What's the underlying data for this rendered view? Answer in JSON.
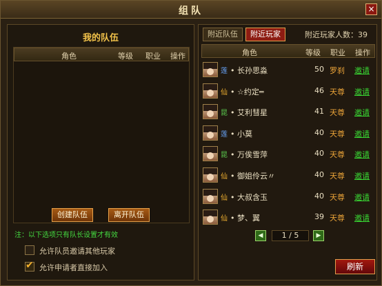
{
  "window": {
    "title": "组队",
    "close_icon": "×"
  },
  "my_team": {
    "title": "我的队伍",
    "columns": [
      "角色",
      "等级",
      "职业",
      "操作"
    ],
    "create_button": "创建队伍",
    "leave_button": "离开队伍",
    "note": "注：以下选项只有队长设置才有效",
    "options": [
      {
        "label": "允许队员邀请其他玩家",
        "checked": false
      },
      {
        "label": "允许申请者直接加入",
        "checked": true
      }
    ],
    "checkmark": "✔"
  },
  "nearby": {
    "tabs": [
      {
        "label": "附近队伍",
        "active": false
      },
      {
        "label": "附近玩家",
        "active": true
      }
    ],
    "count_label": "附近玩家人数：39",
    "columns": [
      "角色",
      "等级",
      "职业",
      "操作"
    ],
    "players": [
      {
        "cls": "莲",
        "cls_color": "#6aa8ff",
        "name": "• 长孙思淼",
        "level": "50",
        "job": "罗刹",
        "action": "邀请"
      },
      {
        "cls": "仙",
        "cls_color": "#f0b030",
        "name": "• ☆约定═",
        "level": "46",
        "job": "天尊",
        "action": "邀请"
      },
      {
        "cls": "昆",
        "cls_color": "#5dd050",
        "name": "• 艾利彗星",
        "level": "41",
        "job": "天尊",
        "action": "邀请"
      },
      {
        "cls": "莲",
        "cls_color": "#6aa8ff",
        "name": "• 小莫",
        "level": "40",
        "job": "天尊",
        "action": "邀请"
      },
      {
        "cls": "昆",
        "cls_color": "#5dd050",
        "name": "• 万俟雪萍",
        "level": "40",
        "job": "天尊",
        "action": "邀请"
      },
      {
        "cls": "仙",
        "cls_color": "#f0b030",
        "name": "• 御姐伶云〃",
        "level": "40",
        "job": "天尊",
        "action": "邀请"
      },
      {
        "cls": "仙",
        "cls_color": "#f0b030",
        "name": "• 大叔含玉",
        "level": "40",
        "job": "天尊",
        "action": "邀请"
      },
      {
        "cls": "仙",
        "cls_color": "#f0b030",
        "name": "• 梦、翼",
        "level": "39",
        "job": "天尊",
        "action": "邀请"
      }
    ],
    "pager": {
      "prev_icon": "◀",
      "text": "1 / 5",
      "next_icon": "▶"
    },
    "refresh_button": "刷新"
  }
}
